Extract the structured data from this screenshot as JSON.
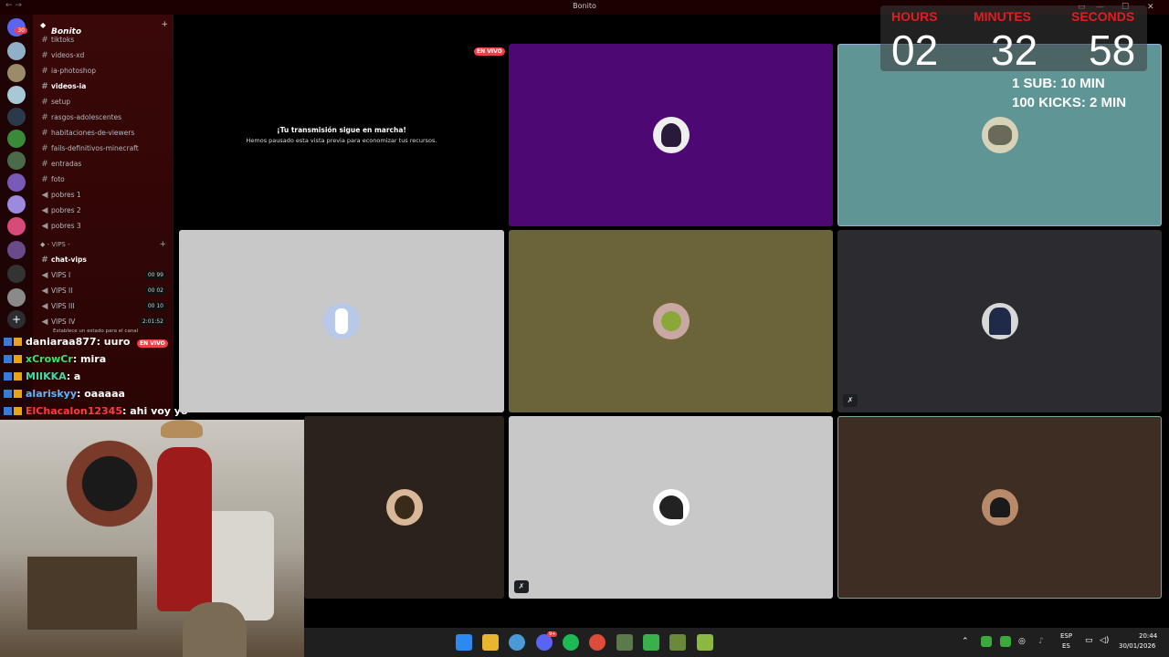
{
  "window": {
    "title": "Bonito",
    "nav": "← →"
  },
  "server": {
    "name": "Bonito",
    "add_icon": "+"
  },
  "rail": {
    "badge": "30"
  },
  "channels": [
    {
      "label": "tiktoks",
      "type": "text"
    },
    {
      "label": "videos-xd",
      "type": "text"
    },
    {
      "label": "ia-photoshop",
      "type": "text"
    },
    {
      "label": "videos-ia",
      "type": "text"
    },
    {
      "label": "setup",
      "type": "text"
    },
    {
      "label": "rasgos-adolescentes",
      "type": "text"
    },
    {
      "label": "habitaciones-de-viewers",
      "type": "text"
    },
    {
      "label": "fails-definitivos-minecraft",
      "type": "text"
    },
    {
      "label": "entradas",
      "type": "text"
    },
    {
      "label": "foto",
      "type": "text"
    },
    {
      "label": "pobres 1",
      "type": "voice"
    },
    {
      "label": "pobres 2",
      "type": "voice"
    },
    {
      "label": "pobres 3",
      "type": "voice"
    }
  ],
  "vips_category": "VIPS",
  "vips_channels": [
    {
      "label": "chat-vips",
      "type": "text",
      "count": ""
    },
    {
      "label": "VIPS I",
      "type": "voice",
      "count": "00 99"
    },
    {
      "label": "VIPS II",
      "type": "voice",
      "count": "00 02"
    },
    {
      "label": "VIPS III",
      "type": "voice",
      "count": "00 10"
    },
    {
      "label": "VIPS IV",
      "type": "voice",
      "count": "2:01:52"
    }
  ],
  "status_hint": "Establece un estado para el canal",
  "chat": [
    {
      "user": "daniaraa877",
      "msg": ": uuro",
      "color": "#ffffff"
    },
    {
      "user": "xCrowCr",
      "msg": ": mira",
      "color": "#3fe06a"
    },
    {
      "user": "MIIKKA",
      "msg": ": a",
      "color": "#3fd9a8"
    },
    {
      "user": "alariskyy",
      "msg": ": oaaaaa",
      "color": "#5fb5ff"
    },
    {
      "user": "ElChacalon12345",
      "msg": ": ahi voy yo",
      "color": "#ff3b3b"
    }
  ],
  "live_label": "EN VIVO",
  "preview": {
    "title": "¡Tu transmisión sigue en marcha!",
    "subtitle": "Hemos pausado esta vista previa para economizar tus recursos."
  },
  "timer": {
    "hours_label": "HOURS",
    "minutes_label": "MINUTES",
    "seconds_label": "SECONDS",
    "hours": "02",
    "minutes": "32",
    "seconds": "58",
    "rule1": "1 SUB: 10 MIN",
    "rule2": "100 KICKS: 2 MIN"
  },
  "tiles": [
    {
      "bg": "#000000"
    },
    {
      "bg": "#4e0873"
    },
    {
      "bg": "#5f9595"
    },
    {
      "bg": "#c8c8c8"
    },
    {
      "bg": "#6b6438"
    },
    {
      "bg": "#2b2b30"
    },
    {
      "bg": "#2b221d"
    },
    {
      "bg": "#c8c8c8"
    },
    {
      "bg": "#3d2d22"
    }
  ],
  "taskbar": {
    "lang1": "ESP",
    "lang2": "ES",
    "time": "20:44",
    "date": "30/01/2026",
    "discord_badge": "9+"
  }
}
